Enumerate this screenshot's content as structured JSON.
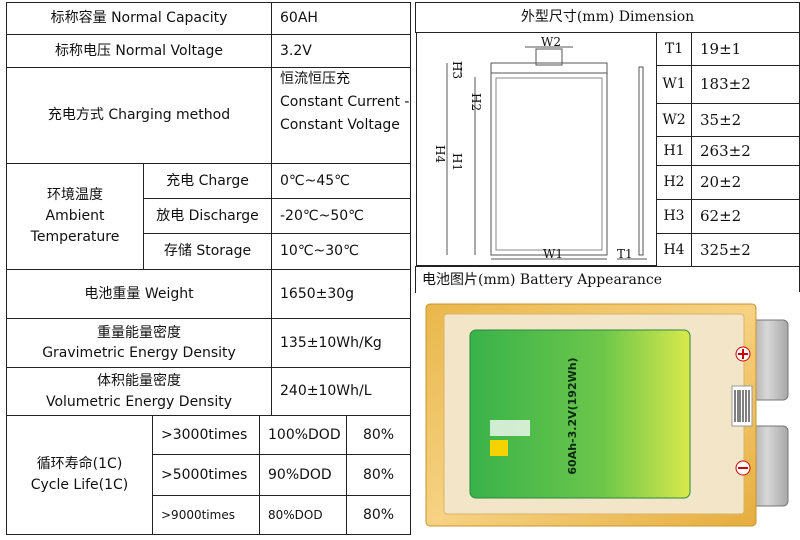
{
  "spec": {
    "capacity": {
      "label": "标称容量  Normal Capacity",
      "value": "60AH"
    },
    "voltage": {
      "label": "标称电压  Normal Voltage",
      "value": "3.2V"
    },
    "charging": {
      "label": "充电方式 Charging method",
      "value_lines": [
        "恒流恒压充",
        "Constant Current -",
        "Constant Voltage"
      ]
    },
    "ambient": {
      "label_lines": [
        "环境温度",
        "Ambient",
        "Temperature"
      ],
      "rows": [
        {
          "label": "充电  Charge",
          "value": "0℃~45℃"
        },
        {
          "label": "放电 Discharge",
          "value": "-20℃~50℃"
        },
        {
          "label": "存储  Storage",
          "value": "10℃~30℃"
        }
      ]
    },
    "weight": {
      "label": "电池重量  Weight",
      "value": "1650±30g"
    },
    "gravimetric": {
      "label_lines": [
        "重量能量密度",
        "Gravimetric Energy Density"
      ],
      "value": "135±10Wh/Kg"
    },
    "volumetric": {
      "label_lines": [
        "体积能量密度",
        "Volumetric Energy Density"
      ],
      "value": "240±10Wh/L"
    },
    "cycle": {
      "label_lines": [
        "循环寿命(1C)",
        "Cycle Life(1C)"
      ],
      "rows": [
        {
          "times": ">3000times",
          "dod": "100%DOD",
          "pct": "80%"
        },
        {
          "times": ">5000times",
          "dod": "90%DOD",
          "pct": "80%"
        },
        {
          "times": ">9000times",
          "dod": "80%DOD",
          "pct": "80%"
        }
      ]
    }
  },
  "dimension": {
    "title": "外型尺寸(mm) Dimension",
    "drawing_labels": {
      "w2": "W2",
      "h3": "H3",
      "h2": "H2",
      "h4": "H4",
      "h1": "H1",
      "w1": "W1",
      "t1": "T1"
    },
    "rows": [
      {
        "key": "T1",
        "value": "19±1"
      },
      {
        "key": "W1",
        "value": "183±2"
      },
      {
        "key": "W2",
        "value": "35±2"
      },
      {
        "key": "H1",
        "value": "263±2"
      },
      {
        "key": "H2",
        "value": "20±2"
      },
      {
        "key": "H3",
        "value": "62±2"
      },
      {
        "key": "H4",
        "value": "325±2"
      }
    ]
  },
  "appearance": {
    "title": "电池图片(mm) Battery Appearance",
    "label_text": "60Ah-3.2V(192Wh)",
    "colors": {
      "film": "#f2c45a",
      "label_green": "#2fae48",
      "tab": "#b8b8b8"
    }
  }
}
